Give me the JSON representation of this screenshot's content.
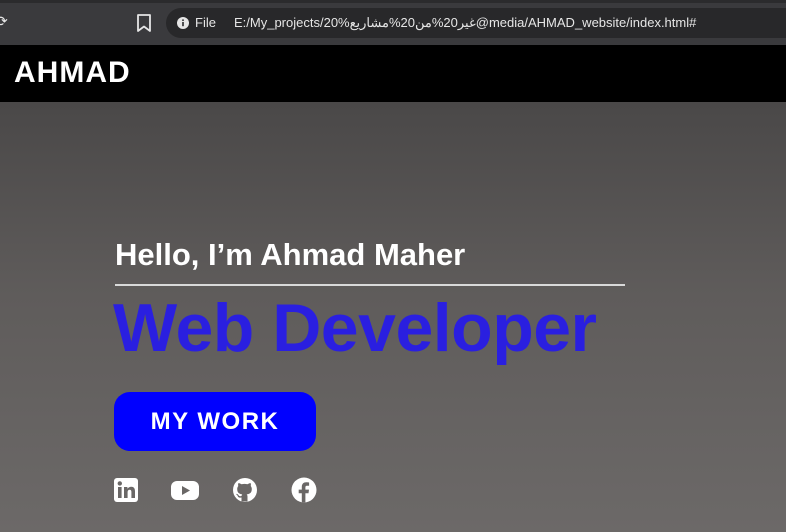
{
  "browser": {
    "file_label": "File",
    "url": "E:/My_projects/20%غير20%من20%مشاريع@media/AHMAD_website/index.html#"
  },
  "header": {
    "logo": "AHMAD"
  },
  "hero": {
    "greeting": "Hello, I’m Ahmad Maher",
    "title": "Web Developer",
    "button_label": "MY WORK"
  },
  "social": [
    {
      "icon": "linkedin-icon"
    },
    {
      "icon": "youtube-icon"
    },
    {
      "icon": "github-icon"
    },
    {
      "icon": "facebook-icon"
    }
  ],
  "colors": {
    "accent": "#0000ff",
    "title": "#2a1fe0",
    "header_bg": "#000000"
  }
}
